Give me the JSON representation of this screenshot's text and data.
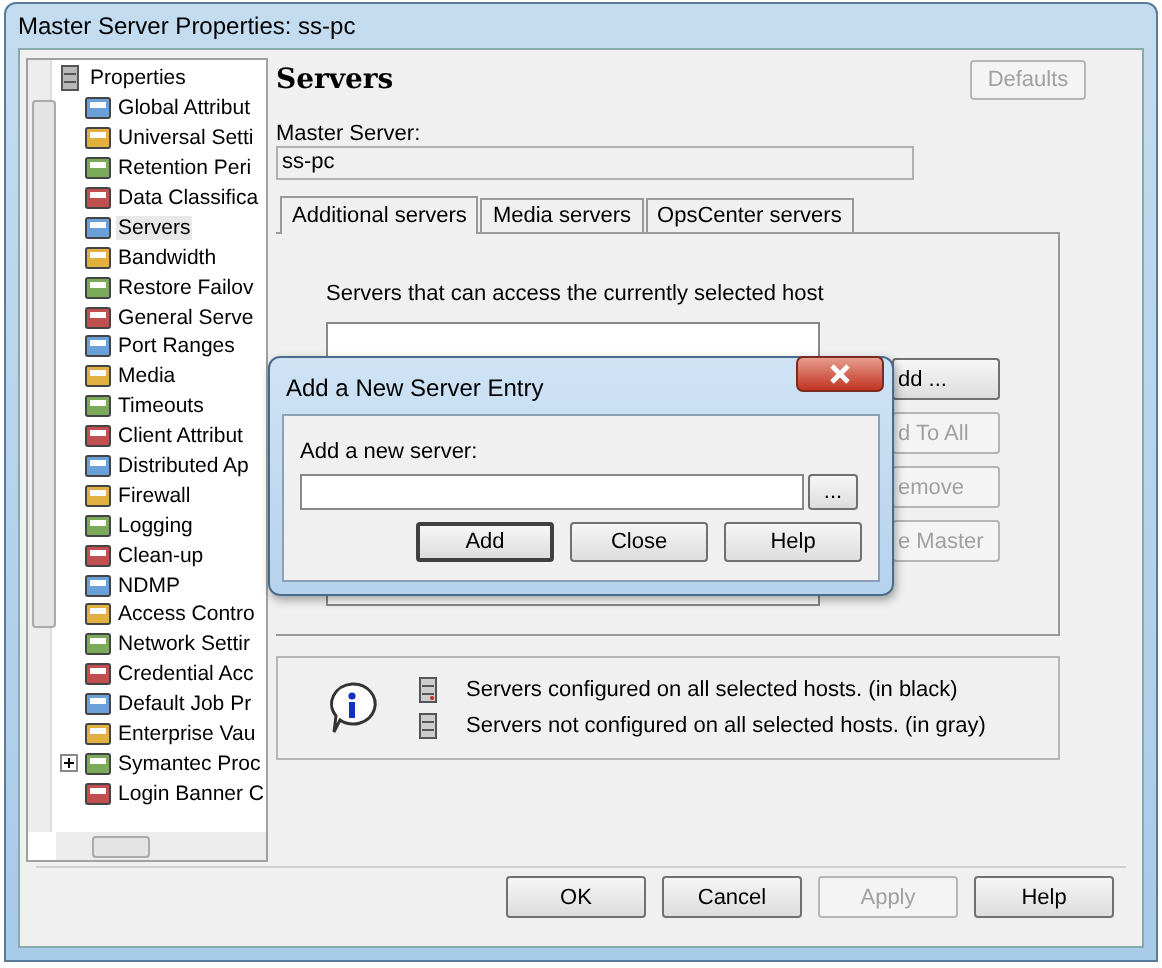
{
  "window": {
    "title": "Master Server Properties: ss-pc"
  },
  "tree": {
    "root": {
      "label": "Properties",
      "expanded": true
    },
    "items": [
      {
        "label": "Global Attribut",
        "kind": "leaf",
        "selected": false
      },
      {
        "label": "Universal Setti",
        "kind": "leaf",
        "selected": false
      },
      {
        "label": "Retention Peri",
        "kind": "leaf",
        "selected": false
      },
      {
        "label": "Data Classifica",
        "kind": "leaf",
        "selected": false
      },
      {
        "label": "Servers",
        "kind": "leaf",
        "selected": true
      },
      {
        "label": "Bandwidth",
        "kind": "leaf",
        "selected": false
      },
      {
        "label": "Restore Failov",
        "kind": "leaf",
        "selected": false
      },
      {
        "label": "General Serve",
        "kind": "leaf",
        "selected": false
      },
      {
        "label": "Port Ranges",
        "kind": "leaf",
        "selected": false
      },
      {
        "label": "Media",
        "kind": "leaf",
        "selected": false
      },
      {
        "label": "Timeouts",
        "kind": "leaf",
        "selected": false
      },
      {
        "label": "Client Attribut",
        "kind": "leaf",
        "selected": false
      },
      {
        "label": "Distributed Ap",
        "kind": "leaf",
        "selected": false
      },
      {
        "label": "Firewall",
        "kind": "leaf",
        "selected": false
      },
      {
        "label": "Logging",
        "kind": "leaf",
        "selected": false
      },
      {
        "label": "Clean-up",
        "kind": "leaf",
        "selected": false
      },
      {
        "label": "NDMP",
        "kind": "leaf",
        "selected": false
      },
      {
        "label": "Access Contro",
        "kind": "leaf",
        "selected": false
      },
      {
        "label": "Network Settir",
        "kind": "leaf",
        "selected": false
      },
      {
        "label": "Credential Acc",
        "kind": "leaf",
        "selected": false
      },
      {
        "label": "Default Job Pr",
        "kind": "leaf",
        "selected": false
      },
      {
        "label": "Enterprise Vau",
        "kind": "leaf",
        "selected": false
      },
      {
        "label": "Symantec Proc",
        "kind": "group",
        "selected": false
      },
      {
        "label": "Login Banner C",
        "kind": "leaf",
        "selected": false
      }
    ]
  },
  "page": {
    "heading": "Servers",
    "defaults_button": {
      "label": "Defaults",
      "disabled": true
    },
    "master_server": {
      "label": "Master Server:",
      "value": "ss-pc"
    },
    "tabs": [
      {
        "label": "Additional servers",
        "selected": true
      },
      {
        "label": "Media servers",
        "selected": false
      },
      {
        "label": "OpsCenter servers",
        "selected": false
      }
    ],
    "list_label": "Servers that can access the currently selected host",
    "side_buttons": [
      {
        "label": "dd ...",
        "disabled": false
      },
      {
        "label": "d To All",
        "disabled": true
      },
      {
        "label": "emove",
        "disabled": true
      },
      {
        "label": "e Master",
        "disabled": true
      }
    ],
    "legend": [
      {
        "text": "Servers configured on all selected hosts. (in black)",
        "configured": true
      },
      {
        "text": "Servers not configured on all selected hosts. (in gray)",
        "configured": false
      }
    ]
  },
  "buttons": [
    {
      "label": "OK",
      "disabled": false
    },
    {
      "label": "Cancel",
      "disabled": false
    },
    {
      "label": "Apply",
      "disabled": true
    },
    {
      "label": "Help",
      "disabled": false
    }
  ],
  "dialog": {
    "title": "Add a New Server Entry",
    "field_label": "Add a new server:",
    "browse": "...",
    "buttons": [
      {
        "label": "Add",
        "default": true
      },
      {
        "label": "Close",
        "default": false
      },
      {
        "label": "Help",
        "default": false
      }
    ]
  }
}
